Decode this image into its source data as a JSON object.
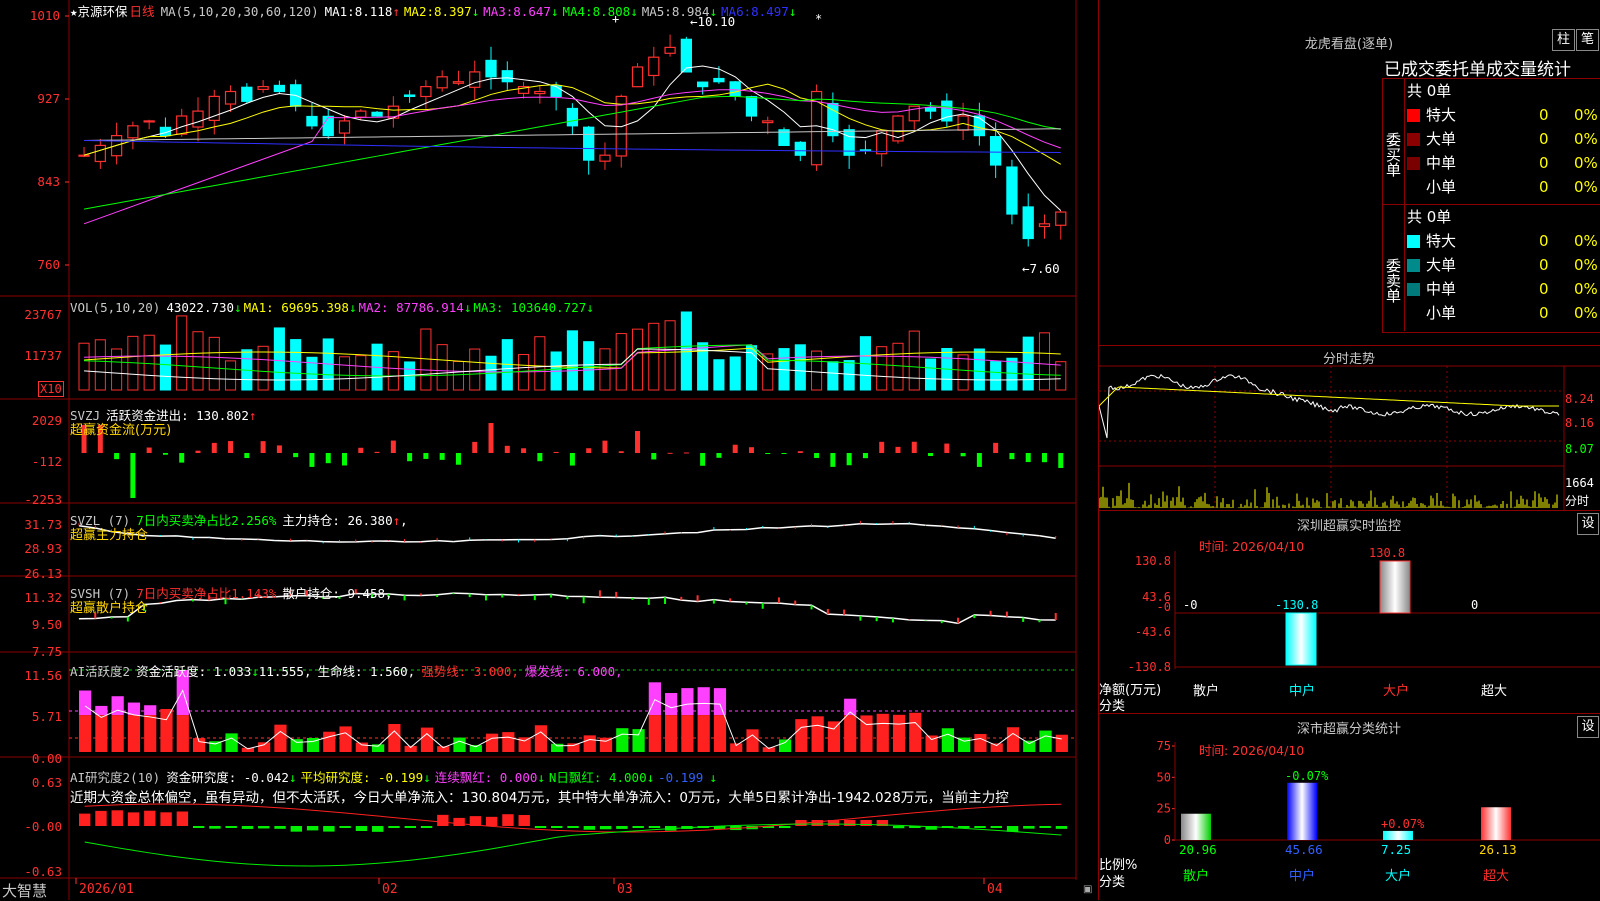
{
  "stock": {
    "star": "★",
    "name": "京源环保",
    "period": "日线"
  },
  "main_header": {
    "ma_def": "MA(5,10,20,30,60,120)",
    "ma": [
      {
        "label": "MA1:",
        "value": "8.118",
        "arrow": "↑",
        "color": "#ffffff"
      },
      {
        "label": "MA2:",
        "value": "8.397",
        "arrow": "↓",
        "color": "#ffff00"
      },
      {
        "label": "MA3:",
        "value": "8.647",
        "arrow": "↓",
        "color": "#ff40ff"
      },
      {
        "label": "MA4:",
        "value": "8.808",
        "arrow": "↓",
        "color": "#00ff00"
      },
      {
        "label": "MA5:",
        "value": "8.984",
        "arrow": "↓",
        "color": "#c8c8c8"
      },
      {
        "label": "MA6:",
        "value": "8.497",
        "arrow": "↓",
        "color": "#3030ff"
      }
    ],
    "high_label": "10.10",
    "low_label": "7.60",
    "markers": [
      "+",
      "*"
    ]
  },
  "price_axis": [
    "1010",
    "927",
    "843",
    "760"
  ],
  "vol_header": {
    "def": "VOL(5,10,20)",
    "v": "43022.730",
    "ma1": "MA1: 69695.398",
    "ma2": "MA2: 87786.914",
    "ma3": "MA3: 103640.727",
    "arrow": "↓"
  },
  "vol_axis": [
    "23767",
    "11737",
    "X10"
  ],
  "svzj_header": {
    "def": "SVZJ",
    "title": "活跃资金进出: 130.802",
    "arrow": "↑",
    "sub": "超赢资金流(万元)"
  },
  "svzj_axis": [
    "2029",
    "-112",
    "-2253"
  ],
  "svzl_header": {
    "def": "SVZL (7)",
    "t1": "7日内买卖净占比2.256%",
    "t2": "主力持仓: 26.380",
    "arrow": "↑",
    "sub": "超赢主力持仓"
  },
  "svzl_axis": [
    "31.73",
    "28.93",
    "26.13"
  ],
  "svsh_header": {
    "def": "SVSH (7)",
    "t1": "7日内买卖净占比1.143%",
    "t2": "散户持仓: 9.458,",
    "sub": "超赢散户持仓"
  },
  "svsh_axis": [
    "11.32",
    "9.50",
    "7.75"
  ],
  "ai1_header": {
    "def": "AI活跃度2",
    "t1": "资金活跃度: 1.033",
    "a1": "↓",
    "t2": "11.555,",
    "t3": "生命线: 1.560,",
    "t4": "强势线: 3.000,",
    "t5": "爆发线: 6.000,"
  },
  "ai1_axis": [
    "11.56",
    "5.71",
    "0.00"
  ],
  "ai2_header": {
    "def": "AI研究度2(10)",
    "t1": "资金研究度: -0.042",
    "a1": "↓",
    "t2": "平均研究度: -0.199",
    "a2": "↓",
    "t3": "连续飘红: 0.000",
    "a3": "↓",
    "t4": "N日飘红: 4.000",
    "a4": "↓",
    "t5": "-0.199",
    "a5": "↓"
  },
  "ai2_text": "近期大资金总体偏空，虽有异动，但不太活跃，今日大单净流入：130.804万元，其中特大单净流入：0万元，大单5日累计净出-1942.028万元，当前主力控",
  "ai2_axis": [
    "0.63",
    "-0.00",
    "-0.63"
  ],
  "x_axis": {
    "brand": "大智慧",
    "dates": [
      "2026/01",
      "02",
      "03",
      "04"
    ]
  },
  "lhb": {
    "title": "龙虎看盘(逐单)",
    "btn1": "柱",
    "btn2": "笔",
    "subtitle": "已成交委托单成交量统计",
    "buy_label": "委买单",
    "sell_label": "委卖单",
    "buy_total": "共 0单",
    "sell_total": "共 0单",
    "rows": [
      {
        "name": "特大",
        "qty": "0",
        "pct": "0%"
      },
      {
        "name": "大单",
        "qty": "0",
        "pct": "0%"
      },
      {
        "name": "中单",
        "qty": "0",
        "pct": "0%"
      },
      {
        "name": "小单",
        "qty": "0",
        "pct": "0%"
      }
    ],
    "buy_colors": [
      "#ff0000",
      "#8b0000",
      "#7a0000",
      ""
    ],
    "sell_colors": [
      "#00ffff",
      "#008b8b",
      "#007a7a",
      ""
    ]
  },
  "intraday": {
    "title": "分时走势",
    "axis": [
      "8.24",
      "8.16",
      "8.07"
    ],
    "vol_axis": [
      "1664",
      "分时"
    ]
  },
  "monitor": {
    "title": "深圳超赢实时监控",
    "btn": "设",
    "time": "时间: 2026/04/10",
    "axis": [
      "130.8",
      "43.6",
      "-0",
      "-43.6",
      "-130.8"
    ],
    "ylabel": "净额(万元)",
    "xlabel": "分类",
    "categories": [
      "散户",
      "中户",
      "大户",
      "超大"
    ],
    "value_labels": [
      "-0",
      "-130.8",
      "130.8",
      "0"
    ]
  },
  "classify": {
    "title": "深市超赢分类统计",
    "btn": "设",
    "time": "时间: 2026/04/10",
    "axis": [
      "75",
      "50",
      "25",
      "0"
    ],
    "ylabel": "比例%",
    "xlabel": "分类",
    "categories": [
      "散户",
      "中户",
      "大户",
      "超大"
    ],
    "values": [
      "20.96",
      "45.66",
      "7.25",
      "26.13"
    ],
    "deltas": [
      "",
      "-0.07%",
      "+0.07%",
      ""
    ]
  },
  "chart_data": [
    {
      "type": "candlestick",
      "title": "京源环保 日线",
      "ylim": [
        7.6,
        10.1
      ],
      "x": [
        "2026/01",
        "02",
        "03",
        "04"
      ],
      "series": [
        {
          "name": "MA1",
          "last": 8.118
        },
        {
          "name": "MA2",
          "last": 8.397
        },
        {
          "name": "MA3",
          "last": 8.647
        },
        {
          "name": "MA4",
          "last": 8.808
        },
        {
          "name": "MA5",
          "last": 8.984
        },
        {
          "name": "MA6",
          "last": 8.497
        }
      ],
      "annotations": {
        "high": 10.1,
        "low": 7.6
      }
    },
    {
      "type": "bar",
      "title": "VOL",
      "last": 43022.73,
      "ma": [
        69695.398,
        87786.914,
        103640.727
      ]
    },
    {
      "type": "bar",
      "title": "超赢资金流(万元)",
      "last": 130.802
    },
    {
      "type": "line",
      "title": "超赢主力持仓",
      "last": 26.38
    },
    {
      "type": "line",
      "title": "超赢散户持仓",
      "last": 9.458
    },
    {
      "type": "bar",
      "title": "AI活跃度2",
      "last": 1.033
    },
    {
      "type": "bar",
      "title": "AI研究度2(10)",
      "last": -0.042
    },
    {
      "type": "bar",
      "title": "深圳超赢实时监控",
      "categories": [
        "散户",
        "中户",
        "大户",
        "超大"
      ],
      "values": [
        0,
        -130.8,
        130.8,
        0
      ],
      "ylim": [
        -130.8,
        130.8
      ]
    },
    {
      "type": "bar",
      "title": "深市超赢分类统计",
      "categories": [
        "散户",
        "中户",
        "大户",
        "超大"
      ],
      "values": [
        20.96,
        45.66,
        7.25,
        26.13
      ],
      "ylim": [
        0,
        75
      ]
    }
  ]
}
